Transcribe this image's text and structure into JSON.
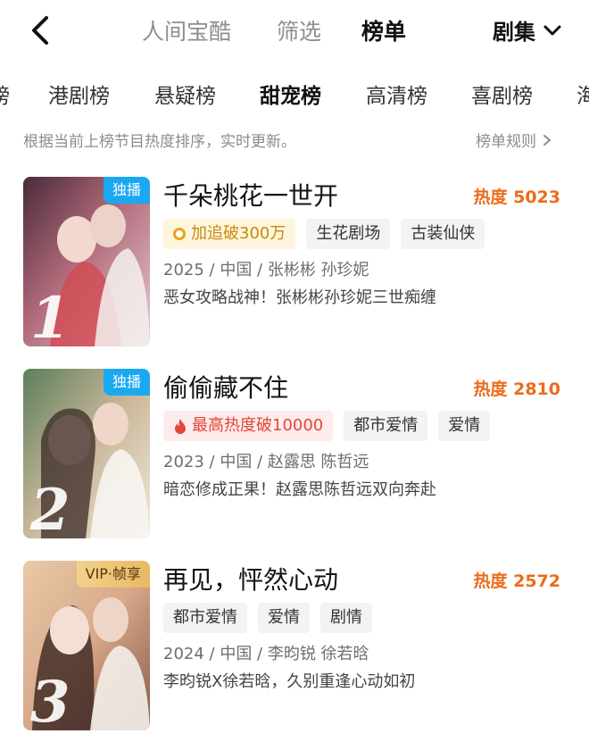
{
  "header": {
    "back_icon": "chevron-left-icon",
    "tabs": [
      {
        "label": "人间宝酷",
        "active": false
      },
      {
        "label": "筛选",
        "active": false
      },
      {
        "label": "榜单",
        "active": true
      }
    ],
    "genre_label": "剧集",
    "genre_icon": "chevron-down-icon"
  },
  "categories": [
    {
      "label": "榜"
    },
    {
      "label": "港剧榜"
    },
    {
      "label": "悬疑榜"
    },
    {
      "label": "甜宠榜",
      "active": true
    },
    {
      "label": "高清榜"
    },
    {
      "label": "喜剧榜"
    },
    {
      "label": "海"
    }
  ],
  "notice": "根据当前上榜节目热度排序，实时更新。",
  "rules_label": "榜单规则",
  "colors": {
    "heat": "#ee6a1c",
    "exclusive_badge": "#1aa8f0",
    "vip_badge": "#e9b864",
    "hot_tag": "#e4453a",
    "follow_tag": "#c98a10"
  },
  "items": [
    {
      "rank": "1",
      "badge": "独播",
      "badge_type": "exclusive",
      "title": "千朵桃花一世开",
      "heat": "热度 5023",
      "highlight_tag": "加追破300万",
      "highlight_type": "follow",
      "tags": [
        "生花剧场",
        "古装仙侠"
      ],
      "meta": "2025 / 中国 / 张彬彬  孙珍妮",
      "desc": "恶女攻略战神！张彬彬孙珍妮三世痴缠",
      "poster_caption": "千朵桃花一世开"
    },
    {
      "rank": "2",
      "badge": "独播",
      "badge_type": "exclusive",
      "title": "偷偷藏不住",
      "heat": "热度 2810",
      "highlight_tag": "最高热度破10000",
      "highlight_type": "hot",
      "tags": [
        "都市爱情",
        "爱情"
      ],
      "meta": "2023 / 中国 / 赵露思  陈哲远",
      "desc": "暗恋修成正果！赵露思陈哲远双向奔赴",
      "poster_caption": "偷偷藏不住"
    },
    {
      "rank": "3",
      "badge": "VIP·帧享",
      "badge_type": "vip",
      "title": "再见，怦然心动",
      "heat": "热度 2572",
      "tags": [
        "都市爱情",
        "爱情",
        "剧情"
      ],
      "meta": "2024 / 中国 / 李昀锐  徐若晗",
      "desc": "李昀锐X徐若晗，久别重逢心动如初",
      "poster_caption": "再见，怦然心动"
    }
  ]
}
